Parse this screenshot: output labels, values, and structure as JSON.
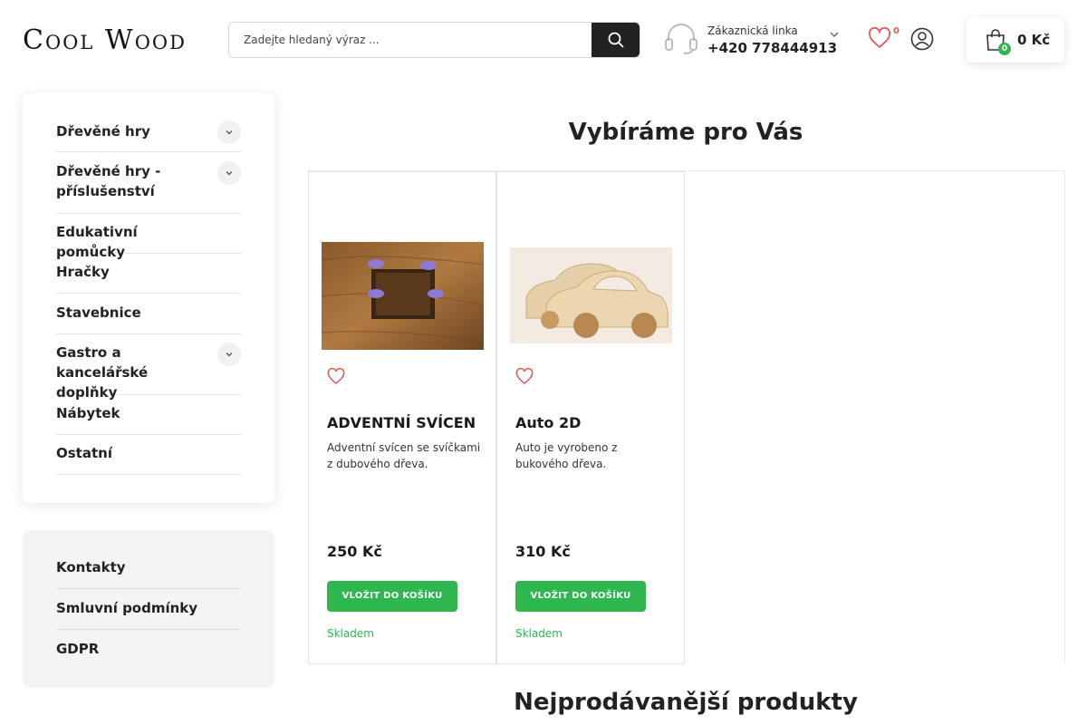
{
  "header": {
    "logo_text": "Cool Wood",
    "search_placeholder": "Zadejte hledaný výraz ...",
    "support_label": "Zákaznická linka",
    "support_phone": "+420 778444913",
    "wishlist_count": "0",
    "cart_count": "0",
    "cart_total": "0 Kč"
  },
  "sidebar": {
    "categories": [
      {
        "label": "Dřevěné hry",
        "expandable": true
      },
      {
        "label": "Dřevěné hry - příslušenství",
        "expandable": true
      },
      {
        "label": "Edukativní pomůcky",
        "expandable": false
      },
      {
        "label": "Hračky",
        "expandable": false
      },
      {
        "label": "Stavebnice",
        "expandable": false
      },
      {
        "label": "Gastro a kancelářské doplňky",
        "expandable": true
      },
      {
        "label": "Nábytek",
        "expandable": false
      },
      {
        "label": "Ostatní",
        "expandable": false
      }
    ],
    "links": [
      {
        "label": "Kontakty"
      },
      {
        "label": "Smluvní podmínky"
      },
      {
        "label": "GDPR"
      }
    ]
  },
  "main": {
    "section_title": "Vybíráme pro Vás",
    "bestsellers_title": "Nejprodávanější produkty",
    "products": [
      {
        "name": "ADVENTNÍ SVÍCEN",
        "description": "Adventní svícen se svíčkami z dubového dřeva.",
        "price": "250 Kč",
        "button": "VLOŽIT DO KOŠÍKU",
        "availability": "Skladem"
      },
      {
        "name": "Auto 2D",
        "description": "Auto je vyrobeno z bukového dřeva.",
        "price": "310 Kč",
        "button": "VLOŽIT DO KOŠÍKU",
        "availability": "Skladem"
      }
    ]
  },
  "colors": {
    "accent": "#2fb74f",
    "dark": "#222222",
    "heart": "#e05a5a"
  }
}
